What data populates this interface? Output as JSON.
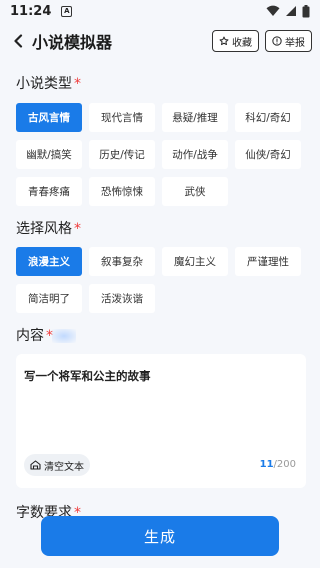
{
  "status": {
    "time": "11:24",
    "badge": "A"
  },
  "nav": {
    "title": "小说模拟器",
    "favorite_label": "收藏",
    "report_label": "举报"
  },
  "sections": {
    "type_label": "小说类型",
    "style_label": "选择风格",
    "content_label": "内容",
    "wordcount_label": "字数要求",
    "required_mark": "*"
  },
  "types": [
    "古风言情",
    "现代言情",
    "悬疑/推理",
    "科幻/奇幻",
    "幽默/搞笑",
    "历史/传记",
    "动作/战争",
    "仙侠/奇幻",
    "青春疼痛",
    "恐怖惊悚",
    "武侠"
  ],
  "selected_type": "古风言情",
  "styles": [
    "浪漫主义",
    "叙事复杂",
    "魔幻主义",
    "严谨理性",
    "简洁明了",
    "活泼诙谐"
  ],
  "selected_style": "浪漫主义",
  "content": {
    "text": "写一个将军和公主的故事",
    "clear_label": "清空文本",
    "count": "11",
    "max": "/200"
  },
  "submit_label": "生成",
  "colors": {
    "accent": "#1a7be8",
    "required": "#ef3b3b"
  }
}
